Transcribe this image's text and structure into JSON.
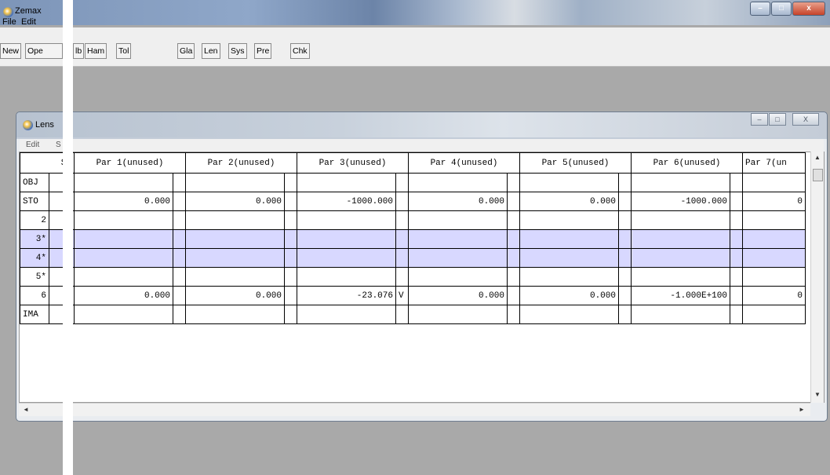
{
  "app": {
    "title": "Zemax",
    "window_buttons": [
      "–",
      "□",
      "x"
    ]
  },
  "menu": [
    "File",
    "Edit"
  ],
  "toolbar": {
    "buttons": [
      "New",
      "Ope",
      "lb",
      "Ham",
      "Tol",
      "Gla",
      "Len",
      "Sys",
      "Pre",
      "Chk"
    ]
  },
  "lens_window": {
    "title": "Lens",
    "menu": [
      "Edit",
      "S"
    ],
    "window_buttons": [
      "–",
      "□",
      "X"
    ],
    "columns": [
      "Su",
      "Par 1(unused)",
      "Par 2(unused)",
      "Par 3(unused)",
      "Par 4(unused)",
      "Par 5(unused)",
      "Par 6(unused)",
      "Par 7(un"
    ],
    "rows": [
      {
        "surf": "OBJ",
        "vals": [
          "",
          "",
          "",
          "",
          "",
          "",
          ""
        ],
        "flags": [
          "",
          "",
          "",
          "",
          "",
          "",
          ""
        ],
        "selected": false
      },
      {
        "surf": "STO",
        "vals": [
          "0.000",
          "0.000",
          "-1000.000",
          "0.000",
          "0.000",
          "-1000.000",
          "0"
        ],
        "flags": [
          "",
          "",
          "",
          "",
          "",
          "",
          ""
        ],
        "selected": false
      },
      {
        "surf": "2",
        "vals": [
          "",
          "",
          "",
          "",
          "",
          "",
          ""
        ],
        "flags": [
          "",
          "",
          "",
          "",
          "",
          "",
          ""
        ],
        "selected": false
      },
      {
        "surf": "3*",
        "vals": [
          "",
          "",
          "",
          "",
          "",
          "",
          ""
        ],
        "flags": [
          "",
          "",
          "",
          "",
          "",
          "",
          ""
        ],
        "selected": true
      },
      {
        "surf": "4*",
        "vals": [
          "",
          "",
          "",
          "",
          "",
          "",
          ""
        ],
        "flags": [
          "",
          "",
          "",
          "",
          "",
          "",
          ""
        ],
        "selected": true
      },
      {
        "surf": "5*",
        "vals": [
          "",
          "",
          "",
          "",
          "",
          "",
          ""
        ],
        "flags": [
          "",
          "",
          "",
          "",
          "",
          "",
          ""
        ],
        "selected": false
      },
      {
        "surf": "6",
        "vals": [
          "0.000",
          "0.000",
          "-23.076",
          "0.000",
          "0.000",
          "-1.000E+100",
          "0"
        ],
        "flags": [
          "",
          "",
          "V",
          "",
          "",
          "",
          ""
        ],
        "selected": false
      },
      {
        "surf": "IMA",
        "vals": [
          "",
          "",
          "",
          "",
          "",
          "",
          ""
        ],
        "flags": [
          "",
          "",
          "",
          "",
          "",
          "",
          ""
        ],
        "selected": false
      }
    ],
    "scroll_arrows": {
      "up": "▲",
      "down": "▼",
      "left": "◄",
      "right": "►"
    }
  }
}
